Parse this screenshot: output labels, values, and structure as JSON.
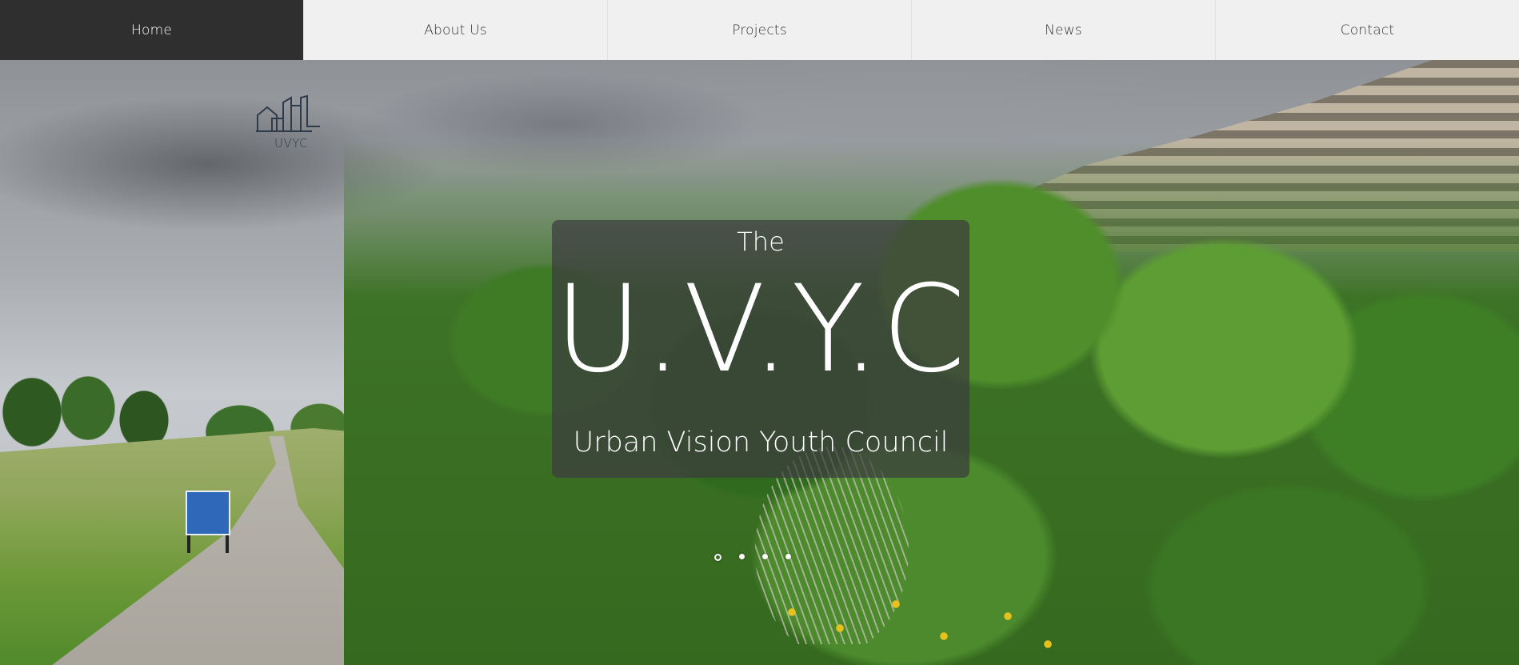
{
  "nav": {
    "items": [
      {
        "label": "Home",
        "active": true
      },
      {
        "label": "About Us",
        "active": false
      },
      {
        "label": "Projects",
        "active": false
      },
      {
        "label": "News",
        "active": false
      },
      {
        "label": "Contact",
        "active": false
      }
    ]
  },
  "logo": {
    "text": "UVYC",
    "icon": "city-skyline-icon"
  },
  "hero": {
    "pretitle": "The",
    "title": "U.V.Y.C",
    "subtitle": "Urban Vision Youth Council",
    "slides": {
      "count": 4,
      "active_index": 0
    }
  },
  "colors": {
    "nav_bg": "#f0f0f0",
    "nav_active_bg": "#2f2f2f",
    "overlay_bg": "#3c3c3e"
  }
}
